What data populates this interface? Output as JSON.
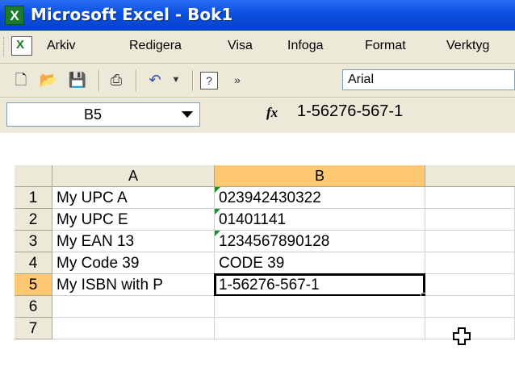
{
  "window": {
    "title": "Microsoft Excel - Bok1"
  },
  "menu": [
    "Arkiv",
    "Redigera",
    "Visa",
    "Infoga",
    "Format",
    "Verktyg"
  ],
  "toolbar": {
    "font_name": "Arial"
  },
  "formula_bar": {
    "name_box": "B5",
    "fx_label": "fx",
    "content": "1-56276-567-1"
  },
  "grid": {
    "columns": [
      "A",
      "B"
    ],
    "rows": [
      {
        "row": "1",
        "a": "My UPC A",
        "b": "023942430322",
        "b_text_marker": true
      },
      {
        "row": "2",
        "a": "My UPC E",
        "b": "01401141",
        "b_text_marker": true
      },
      {
        "row": "3",
        "a": "My EAN 13",
        "b": "1234567890128",
        "b_text_marker": true
      },
      {
        "row": "4",
        "a": "My Code 39",
        "b": "CODE 39",
        "b_text_marker": false
      },
      {
        "row": "5",
        "a": "My ISBN with P",
        "b": "1-56276-567-1",
        "b_text_marker": false
      },
      {
        "row": "6",
        "a": "",
        "b": "",
        "b_text_marker": false
      },
      {
        "row": "7",
        "a": "",
        "b": "",
        "b_text_marker": false
      }
    ],
    "selected_cell": "B5"
  },
  "colors": {
    "title_bar": "#0a4fe0",
    "selected_header": "#ffc873",
    "text_marker": "#1f8f2a"
  }
}
